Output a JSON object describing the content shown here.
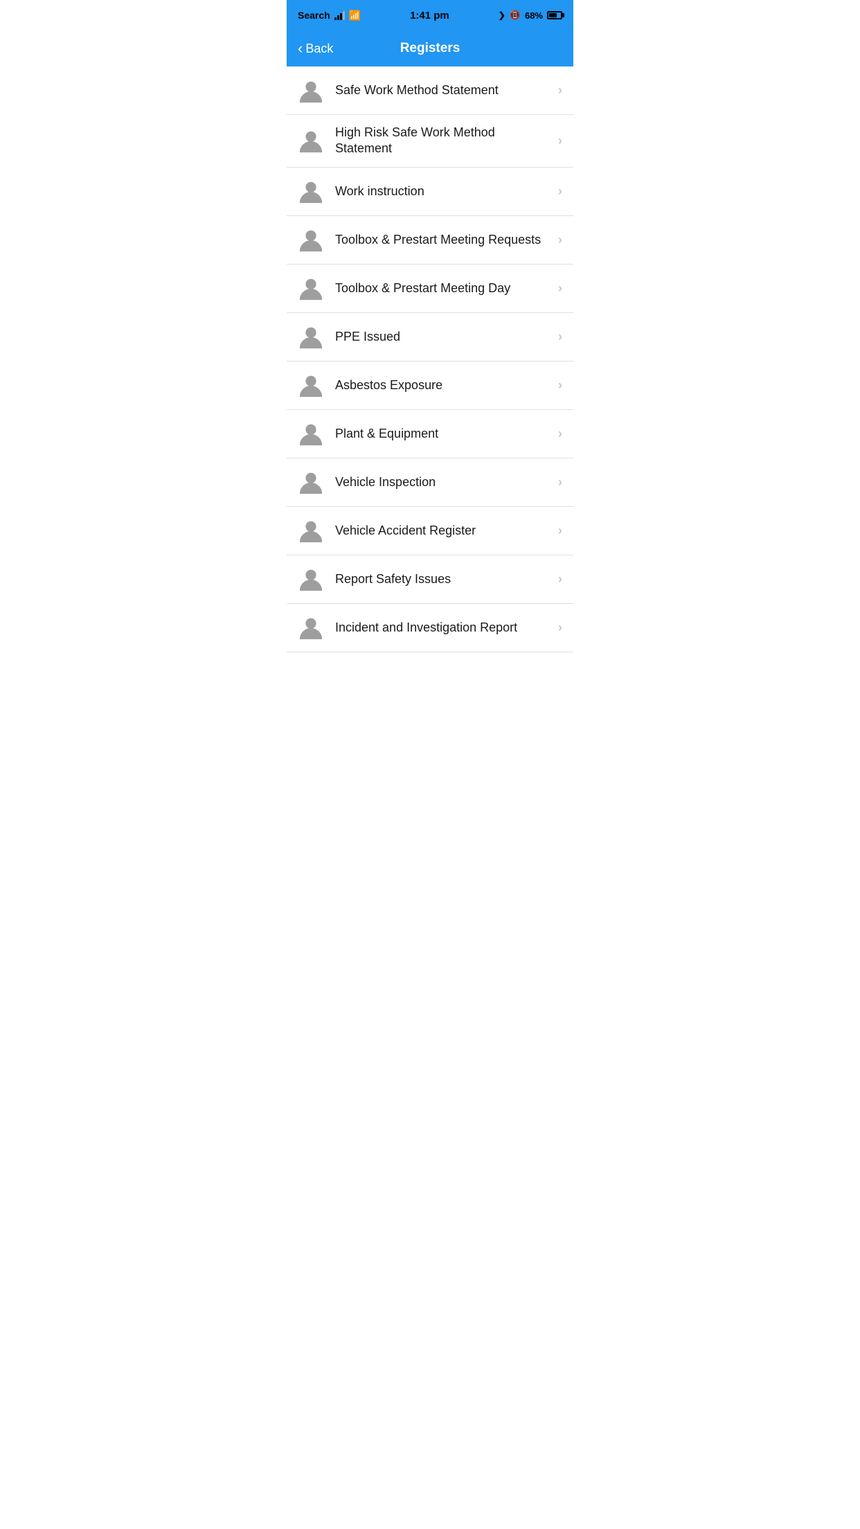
{
  "statusBar": {
    "carrier": "Search",
    "time": "1:41 pm",
    "battery": "68%",
    "batteryFill": 68
  },
  "navBar": {
    "backLabel": "Back",
    "title": "Registers"
  },
  "listItems": [
    {
      "id": 1,
      "label": "Safe Work Method Statement"
    },
    {
      "id": 2,
      "label": "High Risk Safe Work Method Statement"
    },
    {
      "id": 3,
      "label": "Work instruction"
    },
    {
      "id": 4,
      "label": "Toolbox & Prestart Meeting Requests"
    },
    {
      "id": 5,
      "label": "Toolbox & Prestart Meeting Day"
    },
    {
      "id": 6,
      "label": "PPE Issued"
    },
    {
      "id": 7,
      "label": "Asbestos Exposure"
    },
    {
      "id": 8,
      "label": "Plant & Equipment"
    },
    {
      "id": 9,
      "label": "Vehicle Inspection"
    },
    {
      "id": 10,
      "label": "Vehicle Accident Register"
    },
    {
      "id": 11,
      "label": "Report Safety Issues"
    },
    {
      "id": 12,
      "label": "Incident and Investigation Report"
    }
  ],
  "icons": {
    "personIcon": "person-icon",
    "chevronRight": "chevron-right-icon",
    "backChevron": "back-chevron-icon"
  },
  "colors": {
    "headerBg": "#2196F3",
    "itemBorder": "#e0e0e0",
    "textPrimary": "#1a1a1a",
    "chevronColor": "#c7c7cc",
    "iconColor": "#9e9e9e"
  }
}
